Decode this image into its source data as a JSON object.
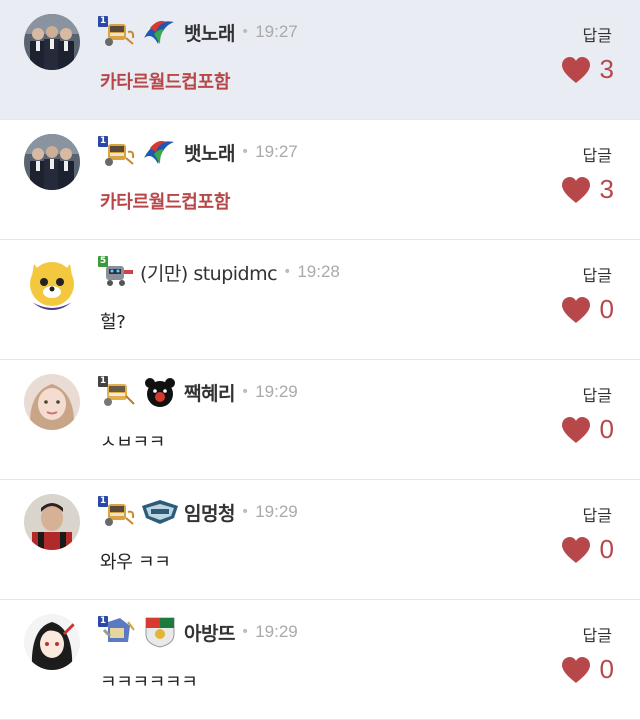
{
  "comments": [
    {
      "author": "뱃노래",
      "time": "19:27",
      "text": "카타르월드컵포함",
      "text_red": true,
      "level": "1",
      "level_color": "#2b4aa8",
      "reply_label": "답글",
      "likes": "3",
      "highlight": true,
      "avatar": "men-suits",
      "team": "swoosh",
      "rank": "miner"
    },
    {
      "author": "뱃노래",
      "time": "19:27",
      "text": "카타르월드컵포함",
      "text_red": true,
      "level": "1",
      "level_color": "#2b4aa8",
      "reply_label": "답글",
      "likes": "3",
      "highlight": false,
      "avatar": "men-suits",
      "team": "swoosh",
      "rank": "miner"
    },
    {
      "author": "(기만) stupidmc",
      "time": "19:28",
      "text": "헐?",
      "text_red": false,
      "level": "5",
      "level_color": "#3c9a3c",
      "reply_label": "답글",
      "likes": "0",
      "highlight": false,
      "avatar": "tiger",
      "team": "",
      "rank": "robot"
    },
    {
      "author": "짹혜리",
      "time": "19:29",
      "text": "ㅅㅂㅋㅋ",
      "text_red": false,
      "level": "1",
      "level_color": "#444444",
      "reply_label": "답글",
      "likes": "0",
      "highlight": false,
      "avatar": "girl",
      "team": "bear",
      "rank": "miner2"
    },
    {
      "author": "임멍청",
      "time": "19:29",
      "text": "와우 ㅋㅋ",
      "text_red": false,
      "level": "1",
      "level_color": "#2b4aa8",
      "reply_label": "답글",
      "likes": "0",
      "highlight": false,
      "avatar": "man",
      "team": "crest",
      "rank": "miner"
    },
    {
      "author": "아방뜨",
      "time": "19:29",
      "text": "ㅋㅋㅋㅋㅋㅋ",
      "text_red": false,
      "level": "1",
      "level_color": "#2b4aa8",
      "reply_label": "답글",
      "likes": "0",
      "highlight": false,
      "avatar": "anime",
      "team": "shield",
      "rank": "knight"
    }
  ],
  "colors": {
    "accent": "#b8474a",
    "highlight_bg": "#e9ecf3"
  },
  "icons": {
    "heart": "heart-icon",
    "level": "level-badge-icon"
  }
}
